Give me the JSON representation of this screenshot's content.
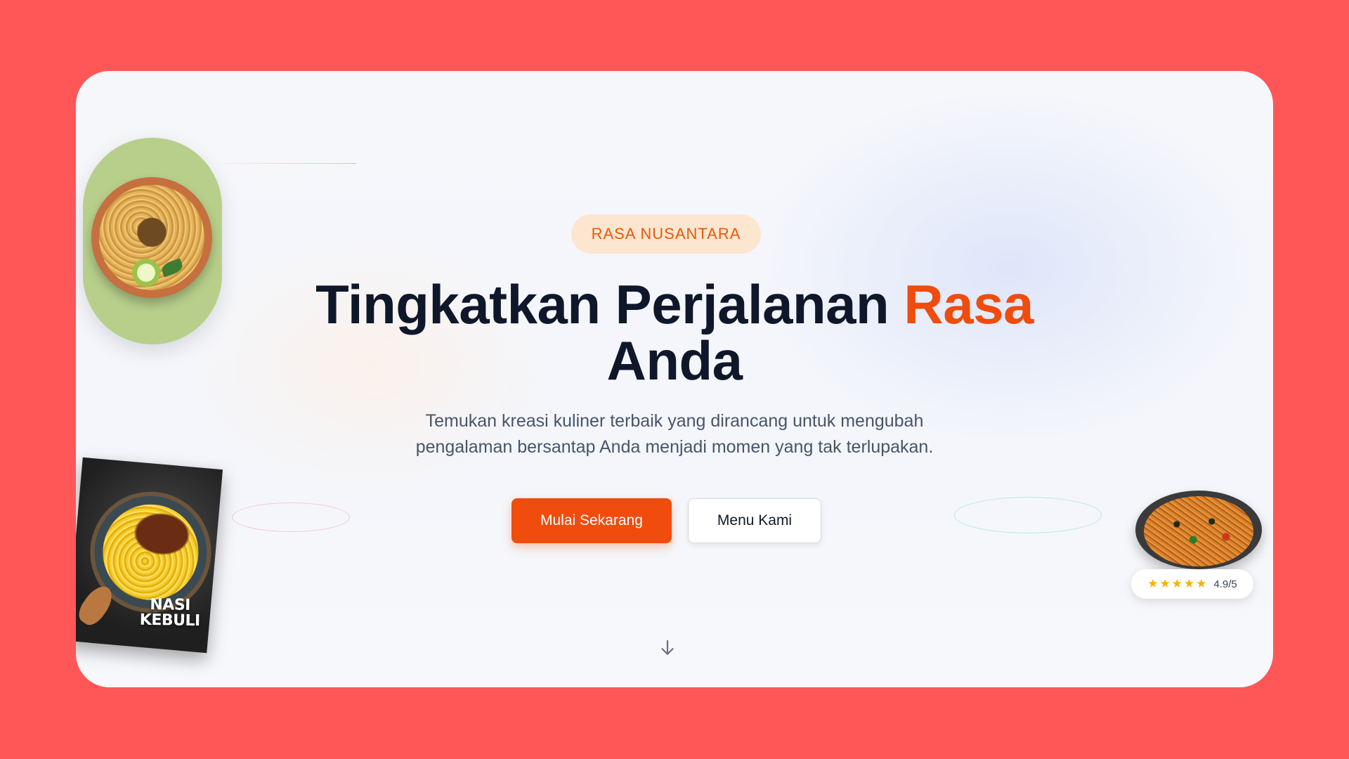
{
  "hero": {
    "badge": "RASA NUSANTARA",
    "headline_main": "Tingkatkan Perjalanan ",
    "headline_accent": "Rasa",
    "headline_end": "Anda",
    "subtitle_line1": "Temukan kreasi kuliner terbaik yang dirancang untuk mengubah",
    "subtitle_line2": "pengalaman bersantap Anda menjadi momen yang tak terlupakan.",
    "primary_button": "Mulai Sekarang",
    "secondary_button": "Menu Kami"
  },
  "book_cover": {
    "title_line1": "NASI",
    "title_line2": "KEBULI"
  },
  "rating": {
    "stars": "★★★★★",
    "value": "4.9/5",
    "score": 4.9,
    "max": 5
  },
  "icons": {
    "scroll": "arrow-down-icon",
    "star": "star-icon"
  },
  "colors": {
    "page_background": "#FF5757",
    "accent": "#f04c0d",
    "headline": "#0f172a",
    "badge_background": "#fde6cf",
    "star": "#f5b301"
  }
}
